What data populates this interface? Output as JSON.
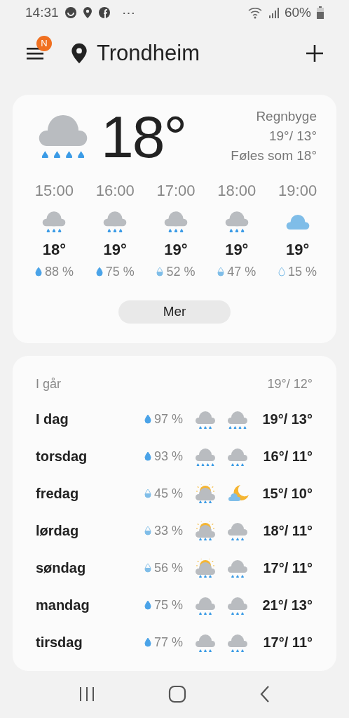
{
  "status_bar": {
    "time": "14:31",
    "more": "⋯",
    "battery": "60%"
  },
  "header": {
    "badge": "N",
    "city": "Trondheim"
  },
  "current": {
    "kind": "heavy-rain",
    "temp": "18°",
    "condition": "Regnbyge",
    "high_low": "19°/ 13°",
    "feels_like": "Føles som 18°"
  },
  "hourly": [
    {
      "time": "15:00",
      "kind": "rain",
      "temp": "18°",
      "drop": {
        "kind": "full"
      },
      "chance": "88 %"
    },
    {
      "time": "16:00",
      "kind": "rain",
      "temp": "19°",
      "drop": {
        "kind": "full"
      },
      "chance": "75 %"
    },
    {
      "time": "17:00",
      "kind": "rain",
      "temp": "19°",
      "drop": {
        "kind": "half"
      },
      "chance": "52 %"
    },
    {
      "time": "18:00",
      "kind": "rain",
      "temp": "19°",
      "drop": {
        "kind": "half"
      },
      "chance": "47 %"
    },
    {
      "time": "19:00",
      "kind": "cloud",
      "temp": "19°",
      "drop": {
        "kind": "empty"
      },
      "chance": "15 %"
    }
  ],
  "more_button": "Mer",
  "yesterday": {
    "label": "I går",
    "high_low": "19°/ 12°"
  },
  "daily": [
    {
      "day": "I dag",
      "drop": {
        "kind": "full"
      },
      "chance": "97 %",
      "icons": [
        {
          "kind": "rain"
        },
        {
          "kind": "heavy-rain"
        }
      ],
      "high_low": "19°/ 13°"
    },
    {
      "day": "torsdag",
      "drop": {
        "kind": "full"
      },
      "chance": "93 %",
      "icons": [
        {
          "kind": "heavy-rain"
        },
        {
          "kind": "rain"
        }
      ],
      "high_low": "16°/ 11°"
    },
    {
      "day": "fredag",
      "drop": {
        "kind": "half"
      },
      "chance": "45 %",
      "icons": [
        {
          "kind": "sun-rain"
        },
        {
          "kind": "moon-cloud"
        }
      ],
      "high_low": "15°/ 10°"
    },
    {
      "day": "lørdag",
      "drop": {
        "kind": "half"
      },
      "chance": "33 %",
      "icons": [
        {
          "kind": "sun-rain"
        },
        {
          "kind": "rain"
        }
      ],
      "high_low": "18°/ 11°"
    },
    {
      "day": "søndag",
      "drop": {
        "kind": "half"
      },
      "chance": "56 %",
      "icons": [
        {
          "kind": "sun-rain"
        },
        {
          "kind": "rain"
        }
      ],
      "high_low": "17°/ 11°"
    },
    {
      "day": "mandag",
      "drop": {
        "kind": "full"
      },
      "chance": "75 %",
      "icons": [
        {
          "kind": "rain"
        },
        {
          "kind": "rain"
        }
      ],
      "high_low": "21°/ 13°"
    },
    {
      "day": "tirsdag",
      "drop": {
        "kind": "full"
      },
      "chance": "77 %",
      "icons": [
        {
          "kind": "rain"
        },
        {
          "kind": "rain"
        }
      ],
      "high_low": "17°/ 11°"
    }
  ]
}
